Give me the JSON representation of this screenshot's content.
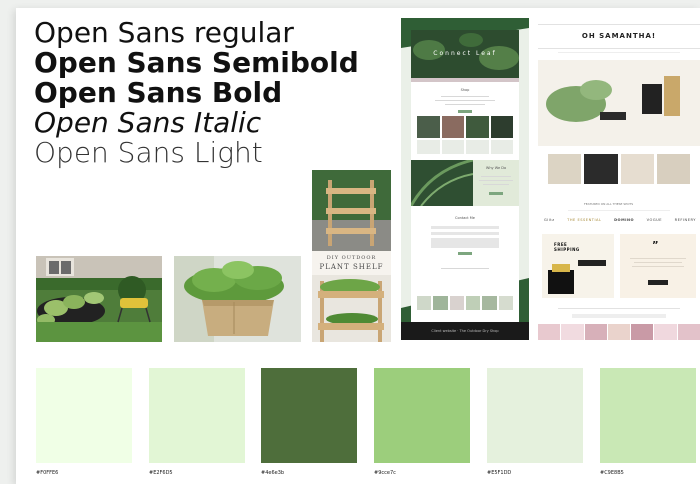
{
  "fonts": {
    "regular": "Open Sans regular",
    "semibold": "Open Sans Semibold",
    "bold": "Open Sans Bold",
    "italic": "Open Sans Italic",
    "light": "Open Sans Light"
  },
  "shelf_card": {
    "small": "DIY OUTDOOR",
    "large": "PLANT SHELF"
  },
  "mockup_connect": {
    "hero": "Connect Leaf",
    "section_shop": "Shop",
    "section_why": "Why We Do",
    "section_contact": "Contact Me",
    "footer": "Client website · The Outdoor Dry Shop"
  },
  "mockup_samantha": {
    "brand": "OH SAMANTHA!",
    "featured": "FEATURED ON ALL THESE SPOTS",
    "logos": [
      "Glitz",
      "THE ESSENTIAL",
      "DOMINO",
      "VOGUE",
      "REFINERY"
    ],
    "free": "FREE",
    "shipping": "SHIPPING"
  },
  "swatches": [
    {
      "color": "#F0FFE6",
      "label": "#F0FFE6"
    },
    {
      "color": "#E2F6D5",
      "label": "#E2F6D5"
    },
    {
      "color": "#4e6e3b",
      "label": "#4e6e3b"
    },
    {
      "color": "#9cce7c",
      "label": "#9cce7c"
    },
    {
      "color": "#E5F1DD",
      "label": "#E5F1DD"
    },
    {
      "color": "#C9E8B5",
      "label": "#C9E8B5"
    }
  ]
}
